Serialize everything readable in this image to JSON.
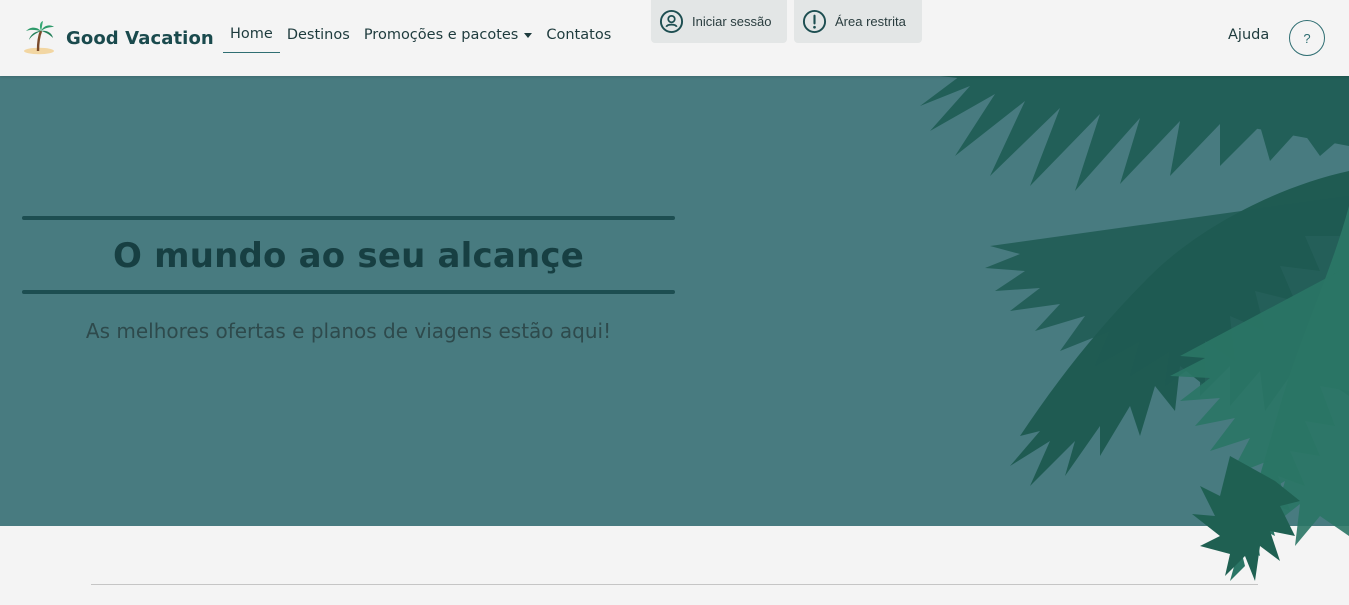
{
  "brand": {
    "name": "Good Vacation",
    "logo_icon": "palm-tree-island-icon"
  },
  "nav": {
    "items": [
      {
        "label": "Home",
        "active": true
      },
      {
        "label": "Destinos"
      },
      {
        "label": "Promoções e pacotes",
        "dropdown": true
      },
      {
        "label": "Contatos"
      }
    ]
  },
  "actions": {
    "login_label": "Iniciar sessão",
    "login_icon": "user-circle-icon",
    "restricted_label": "Área restrita",
    "restricted_icon": "alert-circle-icon",
    "help_label": "Ajuda",
    "help_button": "?"
  },
  "hero": {
    "title": "O mundo ao seu alcançe",
    "subtitle": "As melhores ofertas e planos de viagens estão aqui!",
    "decoration": "fern-leaves-illustration"
  },
  "colors": {
    "hero_bg": "#487b80",
    "brand_dark": "#1a4a4d",
    "accent": "#2f6e72",
    "leaf_dark": "#1f5a50",
    "leaf_light": "#2a7565"
  }
}
